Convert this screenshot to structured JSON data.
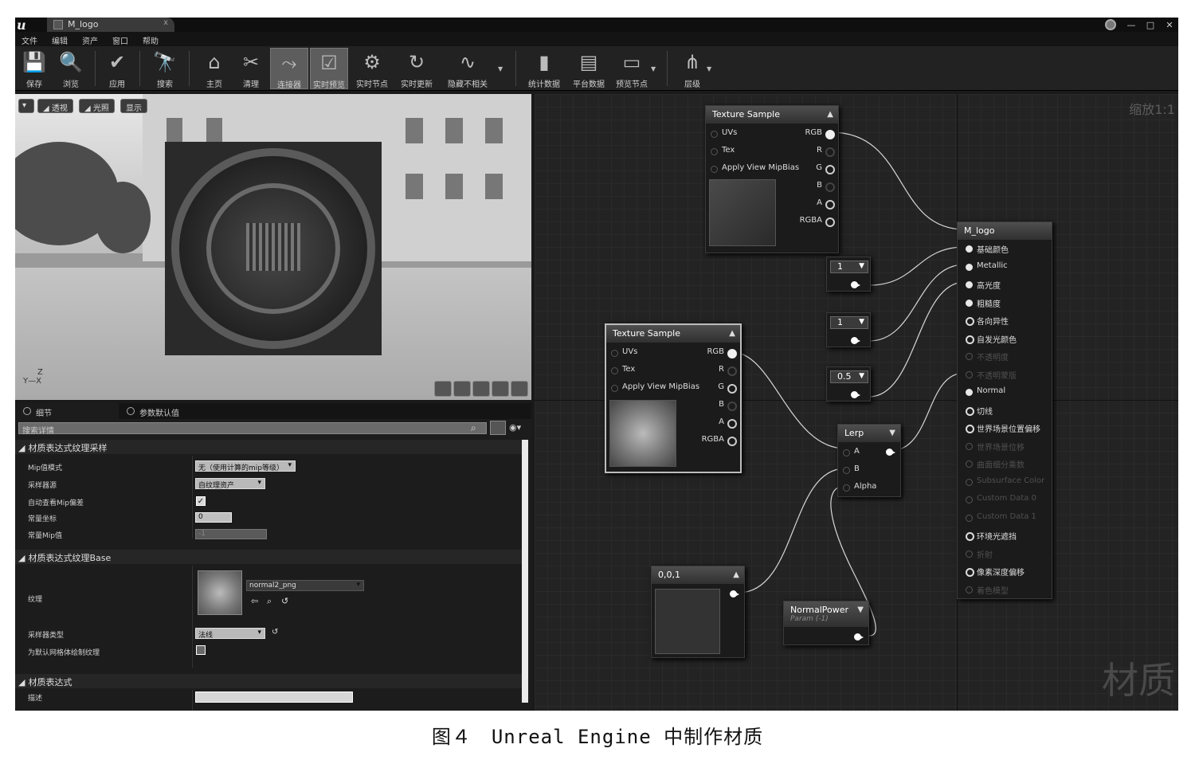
{
  "window": {
    "tab_title": "M_logo",
    "close_glyph": "x",
    "controls": [
      "—",
      "□",
      "✕"
    ]
  },
  "menu": [
    "文件",
    "编辑",
    "资产",
    "窗口",
    "帮助"
  ],
  "toolbar": [
    {
      "label": "保存",
      "icon": "save-icon",
      "glyph": "💾"
    },
    {
      "label": "浏览",
      "icon": "search-icon",
      "glyph": "🔍"
    },
    {
      "label": "应用",
      "icon": "check-icon",
      "glyph": "✔"
    },
    {
      "label": "搜索",
      "icon": "binoculars-icon",
      "glyph": "🔭"
    },
    {
      "label": "主页",
      "icon": "home-icon",
      "glyph": "⌂"
    },
    {
      "label": "清理",
      "icon": "broom-icon",
      "glyph": "✂"
    },
    {
      "label": "连接器",
      "icon": "connector-icon",
      "glyph": "⤳"
    },
    {
      "label": "实时预览",
      "icon": "live-preview-icon",
      "glyph": "☑"
    },
    {
      "label": "实时节点",
      "icon": "live-nodes-icon",
      "glyph": "⚙"
    },
    {
      "label": "实时更新",
      "icon": "live-update-icon",
      "glyph": "↻"
    },
    {
      "label": "隐藏不相关",
      "icon": "hide-unrelated-icon",
      "glyph": "∿"
    },
    {
      "label": "统计数据",
      "icon": "stats-icon",
      "glyph": "▮"
    },
    {
      "label": "平台数据",
      "icon": "platform-stats-icon",
      "glyph": "▤"
    },
    {
      "label": "预览节点",
      "icon": "preview-node-icon",
      "glyph": "▭"
    },
    {
      "label": "层级",
      "icon": "hierarchy-icon",
      "glyph": "⋔"
    }
  ],
  "viewport": {
    "buttons": [
      "透视",
      "光照",
      "显示"
    ],
    "axes": {
      "z": "Z",
      "x": "X",
      "y": "Y"
    }
  },
  "details": {
    "tabs": [
      "细节",
      "参数默认值"
    ],
    "search_placeholder": "搜索详情",
    "categories": [
      {
        "title": "材质表达式纹理采样"
      },
      {
        "title": "材质表达式纹理Base"
      },
      {
        "title": "材质表达式"
      }
    ],
    "props": {
      "mip_mode_label": "Mip值模式",
      "mip_mode_value": "无（使用计算的mip等级）",
      "sampler_source_label": "采样器源",
      "sampler_source_value": "自纹理资产",
      "auto_mip_label": "自动查看Mip偏差",
      "auto_mip_checked": "✓",
      "const_coord_label": "常量坐标",
      "const_coord_value": "0",
      "const_mip_label": "常量Mip值",
      "const_mip_value": "-1",
      "texture_label": "纹理",
      "texture_value": "normal2_png",
      "sampler_type_label": "采样器类型",
      "sampler_type_value": "法线",
      "default_mesh_label": "为默认网格体绘制纹理",
      "desc_label": "描述"
    }
  },
  "graph": {
    "zoom": "缩放1:1",
    "watermark": "材质",
    "ts1": {
      "title": "Texture Sample",
      "inputs": [
        "UVs",
        "Tex",
        "Apply View MipBias"
      ],
      "outputs": [
        "RGB",
        "R",
        "G",
        "B",
        "A",
        "RGBA"
      ]
    },
    "ts2": {
      "title": "Texture Sample",
      "inputs": [
        "UVs",
        "Tex",
        "Apply View MipBias"
      ],
      "outputs": [
        "RGB",
        "R",
        "G",
        "B",
        "A",
        "RGBA"
      ]
    },
    "c1": "1",
    "c2": "1",
    "c3": "0.5",
    "lerp": {
      "title": "Lerp",
      "inputs": [
        "A",
        "B",
        "Alpha"
      ]
    },
    "vec": {
      "title": "0,0,1"
    },
    "np": {
      "title": "NormalPower",
      "sub": "Param (-1)"
    },
    "result": {
      "title": "M_logo",
      "pins": [
        "基础颜色",
        "Metallic",
        "高光度",
        "粗糙度",
        "各向异性",
        "自发光颜色",
        "不透明度",
        "不透明蒙版",
        "Normal",
        "切线",
        "世界场景位置偏移",
        "世界场景位移",
        "曲面细分乘数",
        "Subsurface Color",
        "Custom Data 0",
        "Custom Data 1",
        "环境光遮挡",
        "折射",
        "像素深度偏移",
        "着色模型"
      ],
      "pin_state": [
        "full",
        "full",
        "full",
        "full",
        "ring",
        "ring",
        "dim",
        "dim",
        "full",
        "ring",
        "ring",
        "dim",
        "dim",
        "dim",
        "dim",
        "dim",
        "ring",
        "dim",
        "ring",
        "dim"
      ]
    }
  },
  "caption": "图４　Unreal Engine 中制作材质"
}
